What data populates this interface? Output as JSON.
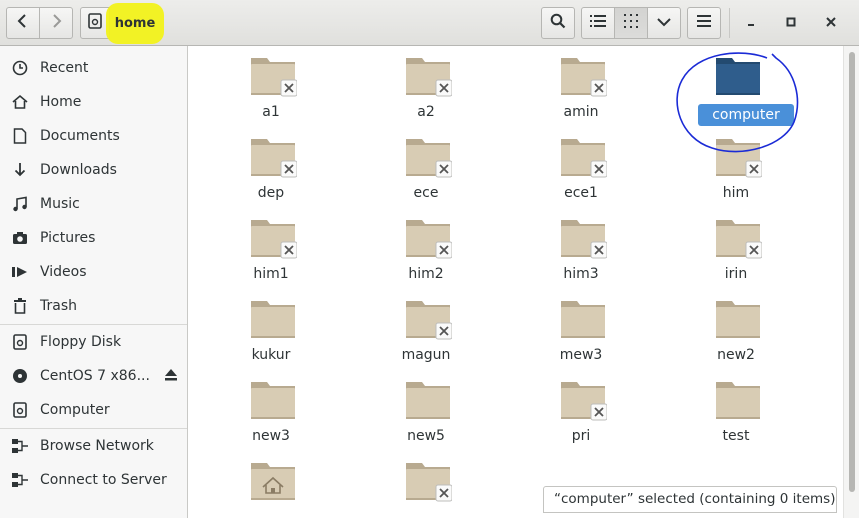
{
  "header": {
    "path_label": "home",
    "colors": {
      "highlight": "#f2f21a"
    }
  },
  "sidebar": {
    "items": [
      {
        "label": "Recent",
        "icon": "clock-icon"
      },
      {
        "label": "Home",
        "icon": "home-icon"
      },
      {
        "label": "Documents",
        "icon": "document-icon"
      },
      {
        "label": "Downloads",
        "icon": "download-icon"
      },
      {
        "label": "Music",
        "icon": "music-icon"
      },
      {
        "label": "Pictures",
        "icon": "camera-icon"
      },
      {
        "label": "Videos",
        "icon": "video-icon"
      },
      {
        "label": "Trash",
        "icon": "trash-icon"
      },
      {
        "label": "Floppy Disk",
        "icon": "floppy-icon"
      },
      {
        "label": "CentOS 7 x86...",
        "icon": "disc-icon"
      },
      {
        "label": "Computer",
        "icon": "computer-icon"
      },
      {
        "label": "Browse Network",
        "icon": "network-icon"
      },
      {
        "label": "Connect to Server",
        "icon": "server-icon"
      }
    ]
  },
  "files": [
    {
      "name": "a1",
      "locked": true
    },
    {
      "name": "a2",
      "locked": true
    },
    {
      "name": "amin",
      "locked": true
    },
    {
      "name": "computer",
      "locked": false,
      "selected": true
    },
    {
      "name": "dep",
      "locked": true
    },
    {
      "name": "ece",
      "locked": true
    },
    {
      "name": "ece1",
      "locked": true
    },
    {
      "name": "him",
      "locked": true
    },
    {
      "name": "him1",
      "locked": true
    },
    {
      "name": "him2",
      "locked": true
    },
    {
      "name": "him3",
      "locked": true
    },
    {
      "name": "irin",
      "locked": true
    },
    {
      "name": "kukur",
      "locked": false
    },
    {
      "name": "magun",
      "locked": true
    },
    {
      "name": "mew3",
      "locked": false
    },
    {
      "name": "new2",
      "locked": false
    },
    {
      "name": "new3",
      "locked": false
    },
    {
      "name": "new5",
      "locked": false
    },
    {
      "name": "pri",
      "locked": true
    },
    {
      "name": "test",
      "locked": false
    },
    {
      "name": "",
      "locked": false,
      "home_folder": true
    },
    {
      "name": "",
      "locked": true
    }
  ],
  "status": {
    "text": "“computer” selected  (containing 0 items)"
  },
  "colors": {
    "selection": "#4a90d9",
    "folder": "#d8ccb4",
    "folder_selected": "#2f5d8c"
  }
}
